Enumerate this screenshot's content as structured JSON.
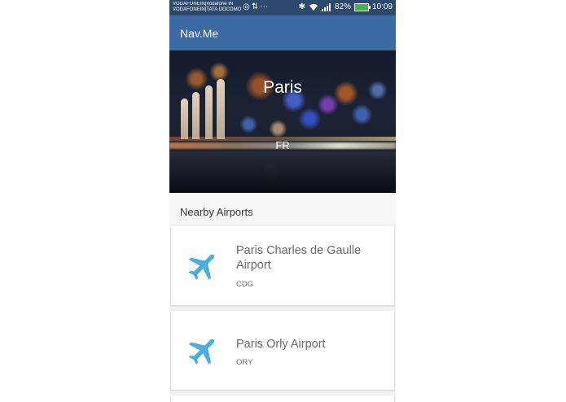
{
  "status_bar": {
    "carrier_line1": "VODAFONEIN|Vodafone IN",
    "carrier_line2": "VODAFONEIN|TATA DOCOMO",
    "battery": "82%",
    "time": "10:09"
  },
  "app_bar": {
    "title": "Nav.Me"
  },
  "hero": {
    "city": "Paris",
    "country": "FR"
  },
  "section": {
    "title": "Nearby Airports"
  },
  "airports": [
    {
      "name": "Paris Charles de Gaulle Airport",
      "code": "CDG"
    },
    {
      "name": "Paris Orly Airport",
      "code": "ORY"
    }
  ],
  "icons": {
    "airport": "airplane-icon",
    "status": [
      "whatsapp-icon",
      "data-icon",
      "more-icon",
      "bluetooth-icon",
      "wifi-icon",
      "signal-icon",
      "battery-icon"
    ]
  },
  "colors": {
    "status_bar": "#2d4a6e",
    "app_bar": "#3c6aa4",
    "airplane_icon": "#4aaee0"
  }
}
